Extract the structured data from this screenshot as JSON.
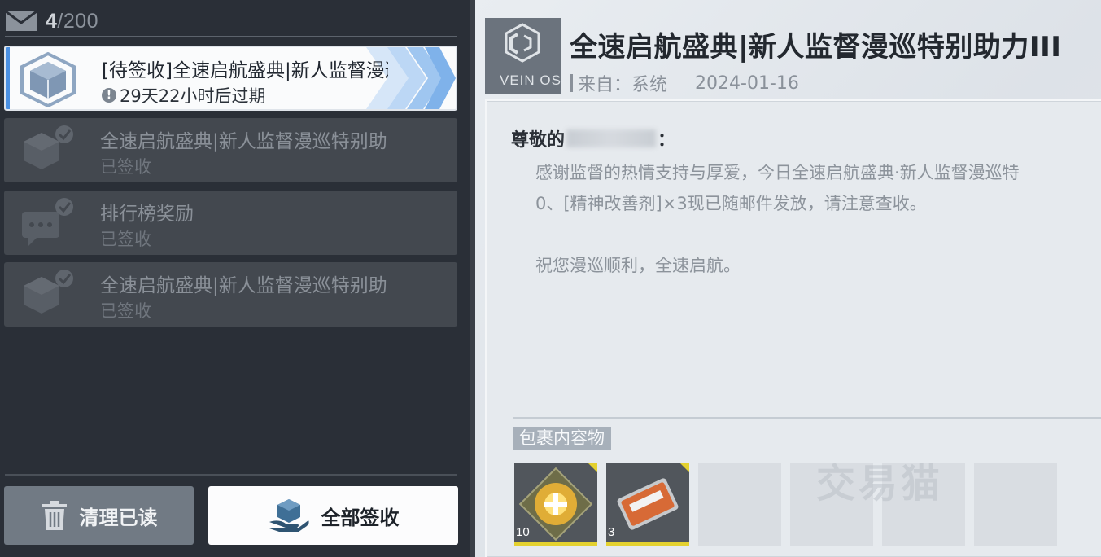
{
  "inbox": {
    "count": "4",
    "total": "/200"
  },
  "mails": [
    {
      "title": "[待签收]全速启航盛典|新人监督漫巡特别助力III",
      "subtitle": "29天22小时后过期",
      "state": "pending",
      "icon": "package-icon"
    },
    {
      "title": "全速启航盛典|新人监督漫巡特别助力III",
      "subtitle": "已签收",
      "state": "read",
      "icon": "package-icon"
    },
    {
      "title": "排行榜奖励",
      "subtitle": "已签收",
      "state": "read",
      "icon": "chat-icon"
    },
    {
      "title": "全速启航盛典|新人监督漫巡特别助力II",
      "subtitle": "已签收",
      "state": "read",
      "icon": "package-icon"
    }
  ],
  "buttons": {
    "clear_read": "清理已读",
    "claim_all": "全部签收"
  },
  "detail": {
    "title": "全速启航盛典|新人监督漫巡特别助力III",
    "from_label": "来自：系统",
    "date": "2024-01-16",
    "greeting_prefix": "尊敬的",
    "greeting_suffix": "：",
    "line1": "感谢监督的热情支持与厚爱，今日全速启航盛典·新人监督漫巡特",
    "line2": "0、[精神改善剂]×3现已随邮件发放，请注意查收。",
    "line3": "祝您漫巡顺利，全速启航。",
    "attachments_label": "包裹内容物",
    "logo_text": "VEIN OS",
    "attachments": [
      {
        "name": "enhancement-item",
        "qty": "10"
      },
      {
        "name": "scope-item",
        "qty": "3"
      }
    ]
  },
  "watermark": "交易猫",
  "colors": {
    "accent": "#4a90e2",
    "rarity_yellow": "#e4d12f"
  }
}
